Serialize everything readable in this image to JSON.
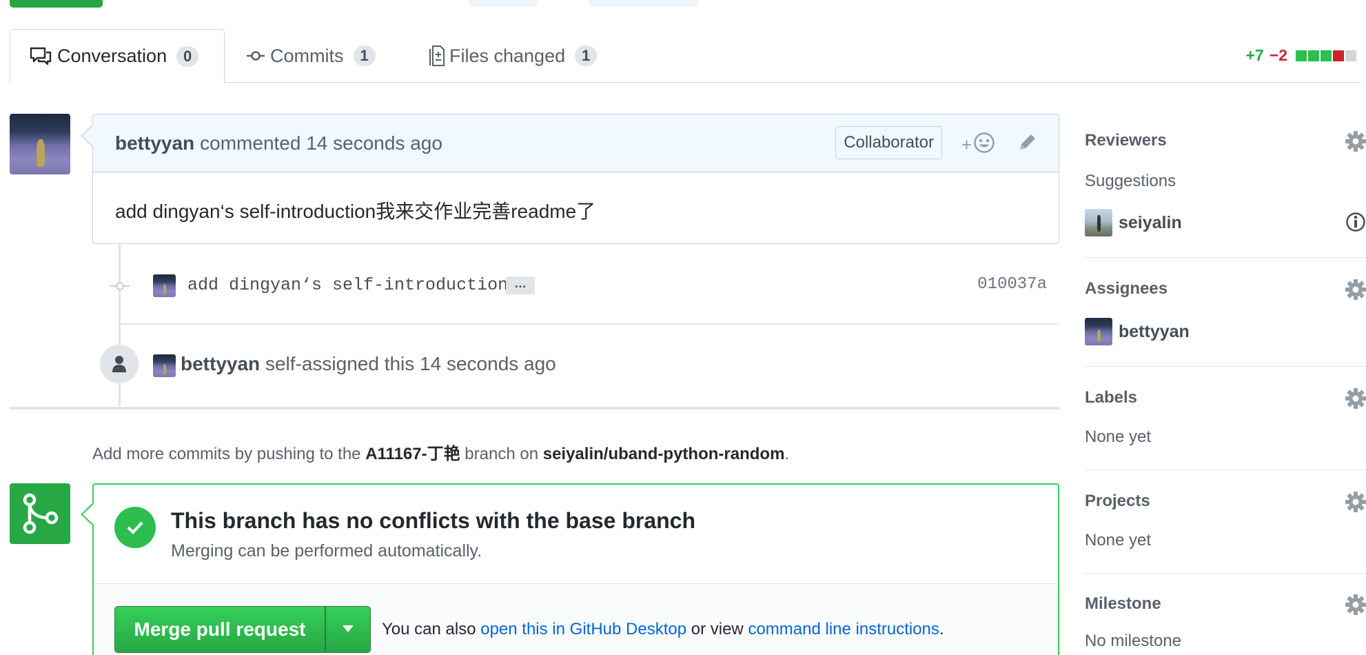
{
  "tabs": [
    {
      "label": "Conversation",
      "count": "0",
      "icon": "comment-discussion-icon"
    },
    {
      "label": "Commits",
      "count": "1",
      "icon": "git-commit-icon"
    },
    {
      "label": "Files changed",
      "count": "1",
      "icon": "file-diff-icon"
    }
  ],
  "diffstat": {
    "additions": "+7",
    "deletions": "−2",
    "colors": {
      "add": "#28a745",
      "del": "#cb2431",
      "neutral": "#d1d5da"
    }
  },
  "comment": {
    "author": "bettyyan",
    "action": "commented 14 seconds ago",
    "badge": "Collaborator",
    "body": "add dingyan‘s self-introduction我来交作业完善readme了"
  },
  "commit": {
    "message": "add dingyan‘s self-introduction",
    "ellipsis": "…",
    "sha": "010037a"
  },
  "assign_event": {
    "author": "bettyyan",
    "text": "self-assigned this 14 seconds ago"
  },
  "push_hint": {
    "prefix": "Add more commits by pushing to the",
    "branch": "A11167-丁艳",
    "middle": "branch on",
    "repo": "seiyalin/uband-python-random",
    "suffix": "."
  },
  "merge": {
    "title": "This branch has no conflicts with the base branch",
    "subtitle": "Merging can be performed automatically.",
    "button": "Merge pull request",
    "also_prefix": "You can also",
    "desktop_link": "open this in GitHub Desktop",
    "also_middle": "or view",
    "cli_link": "command line instructions",
    "also_suffix": "."
  },
  "sidebar": {
    "reviewers": {
      "heading": "Reviewers",
      "suggestions": "Suggestions",
      "suggested_user": "seiyalin"
    },
    "assignees": {
      "heading": "Assignees",
      "user": "bettyyan"
    },
    "labels": {
      "heading": "Labels",
      "value": "None yet"
    },
    "projects": {
      "heading": "Projects",
      "value": "None yet"
    },
    "milestone": {
      "heading": "Milestone",
      "value": "No milestone"
    }
  }
}
